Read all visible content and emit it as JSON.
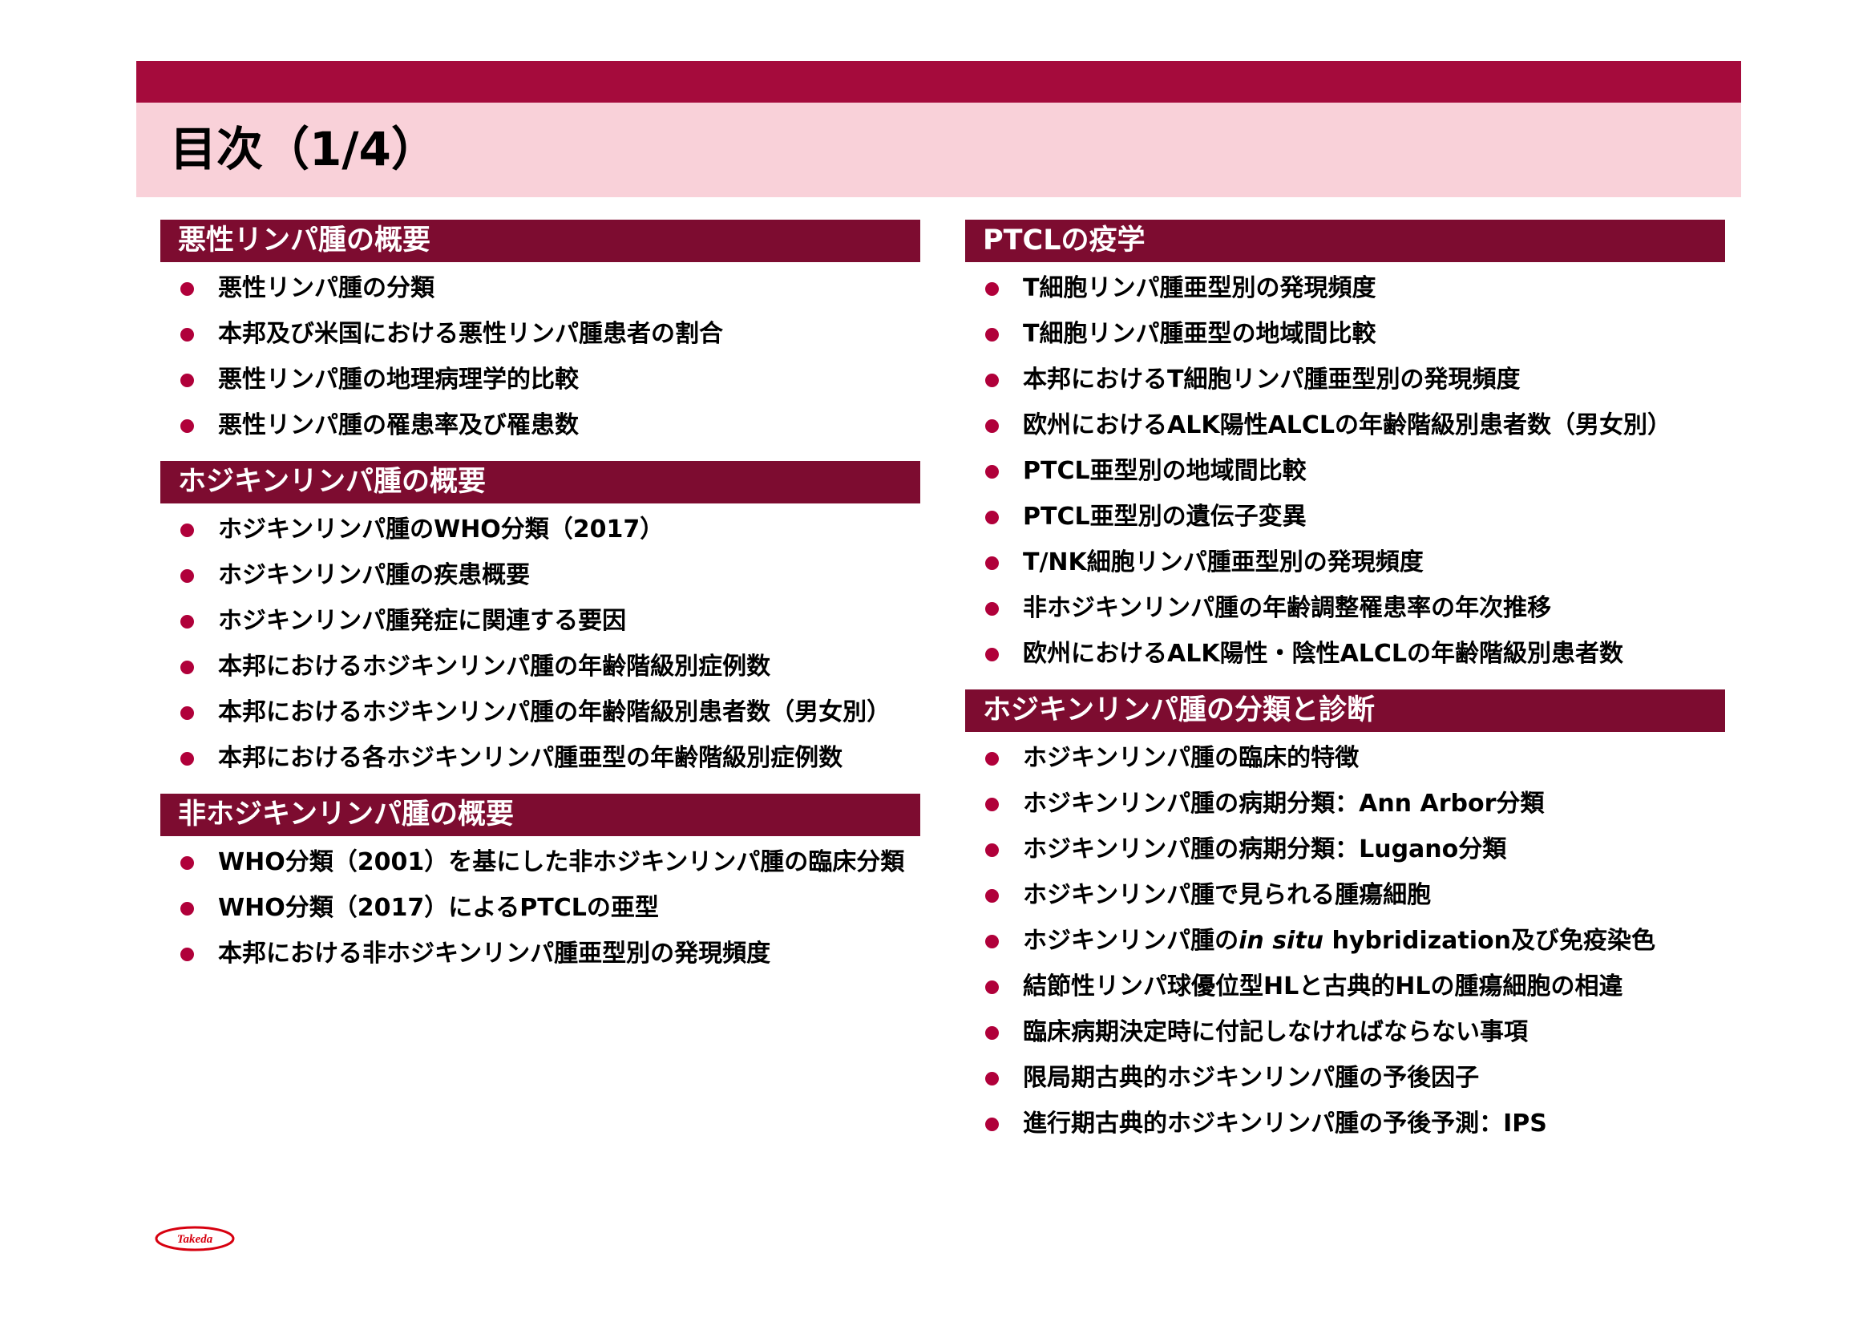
{
  "title": "目次（1/4）",
  "left_sections": [
    {
      "header": "悪性リンパ腫の概要",
      "items": [
        "悪性リンパ腫の分類",
        "本邦及び米国における悪性リンパ腫患者の割合",
        "悪性リンパ腫の地理病理学的比較",
        "悪性リンパ腫の罹患率及び罹患数"
      ]
    },
    {
      "header": "ホジキンリンパ腫の概要",
      "items": [
        "ホジキンリンパ腫のWHO分類（2017）",
        "ホジキンリンパ腫の疾患概要",
        "ホジキンリンパ腫発症に関連する要因",
        "本邦におけるホジキンリンパ腫の年齢階級別症例数",
        "本邦におけるホジキンリンパ腫の年齢階級別患者数（男女別）",
        "本邦における各ホジキンリンパ腫亜型の年齢階級別症例数"
      ]
    },
    {
      "header": "非ホジキンリンパ腫の概要",
      "items": [
        "WHO分類（2001）を基にした非ホジキンリンパ腫の臨床分類",
        "WHO分類（2017）によるPTCLの亜型",
        "本邦における非ホジキンリンパ腫亜型別の発現頻度"
      ]
    }
  ],
  "right_sections": [
    {
      "header": "PTCLの疫学",
      "items": [
        "T細胞リンパ腫亜型別の発現頻度",
        "T細胞リンパ腫亜型の地域間比較",
        "本邦におけるT細胞リンパ腫亜型別の発現頻度",
        "欧州におけるALK陽性ALCLの年齢階級別患者数（男女別）",
        "PTCL亜型別の地域間比較",
        "PTCL亜型別の遺伝子変異",
        "T/NK細胞リンパ腫亜型別の発現頻度",
        "非ホジキンリンパ腫の年齢調整罹患率の年次推移",
        "欧州におけるALK陽性・陰性ALCLの年齢階級別患者数"
      ]
    },
    {
      "header": "ホジキンリンパ腫の分類と診断",
      "items": [
        "ホジキンリンパ腫の臨床的特徴",
        "ホジキンリンパ腫の病期分類：Ann Arbor分類",
        "ホジキンリンパ腫の病期分類：Lugano分類",
        "ホジキンリンパ腫で見られる腫瘍細胞",
        {
          "pre": "ホジキンリンパ腫の",
          "em": "in situ",
          "post": " hybridization及び免疫染色"
        },
        "結節性リンパ球優位型HLと古典的HLの腫瘍細胞の相違",
        "臨床病期決定時に付記しなければならない事項",
        "限局期古典的ホジキンリンパ腫の予後因子",
        "進行期古典的ホジキンリンパ腫の予後予測：IPS"
      ]
    }
  ],
  "logo": {
    "text": "Takeda",
    "color": "#d7000f"
  },
  "colors": {
    "top_bar": "#a50b3c",
    "title_band": "#f9d1d9",
    "section_header": "#7d0c30",
    "bullet": "#b0003a"
  }
}
